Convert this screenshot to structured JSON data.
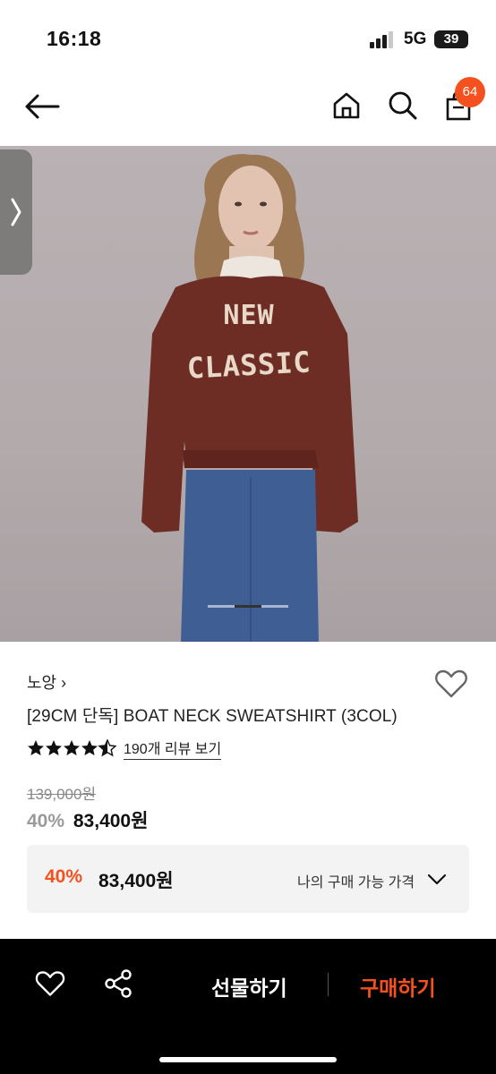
{
  "status_bar": {
    "time": "16:18",
    "network": "5G",
    "battery": "39"
  },
  "nav": {
    "back_icon": "arrow-left-icon",
    "home_icon": "home-icon",
    "search_icon": "search-icon",
    "cart_icon": "shopping-bag-icon",
    "cart_badge": "64"
  },
  "product": {
    "image_print_line1": "NEW",
    "image_print_line2": "CLASSIC",
    "brand": "노앙 ›",
    "title": "[29CM 단독] BOAT NECK SWEATSHIRT (3COL)",
    "rating": 4.5,
    "reviews_label": "190개 리뷰 보기",
    "original_price": "139,000원",
    "discount_pct": "40%",
    "sale_price": "83,400원"
  },
  "benefit": {
    "discount_pct": "40%",
    "price": "83,400원",
    "label": "나의 구매 가능 가격"
  },
  "bottom_bar": {
    "gift_label": "선물하기",
    "buy_label": "구매하기"
  },
  "colors": {
    "accent": "#f4511e",
    "bar": "#000000"
  }
}
